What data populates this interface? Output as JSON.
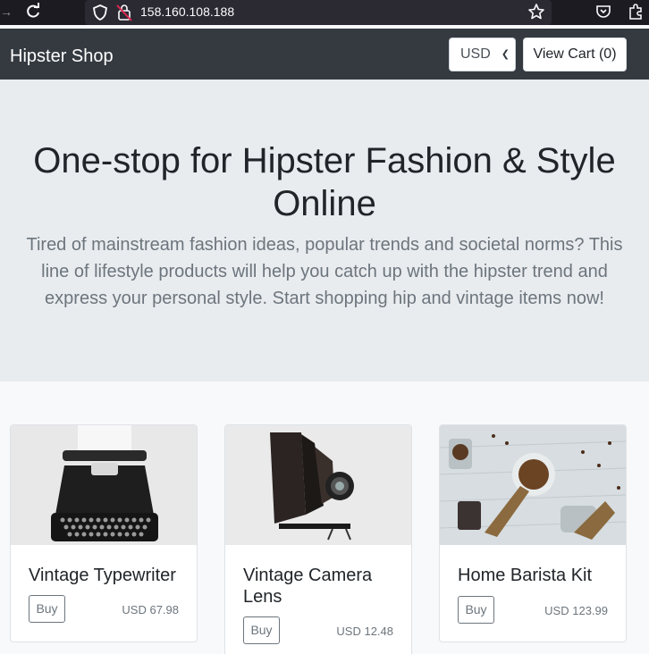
{
  "browser": {
    "url": "158.160.108.188"
  },
  "nav": {
    "brand": "Hipster Shop",
    "currency": "USD",
    "cart_label": "View Cart (0)"
  },
  "hero": {
    "headline": "One-stop for Hipster Fashion & Style Online",
    "tagline": "Tired of mainstream fashion ideas, popular trends and societal norms? This line of lifestyle products will help you catch up with the hipster trend and express your personal style. Start shopping hip and vintage items now!"
  },
  "products": [
    {
      "name": "Vintage Typewriter",
      "buy_label": "Buy",
      "price": "USD 67.98"
    },
    {
      "name": "Vintage Camera Lens",
      "buy_label": "Buy",
      "price": "USD 12.48"
    },
    {
      "name": "Home Barista Kit",
      "buy_label": "Buy",
      "price": "USD 123.99"
    }
  ],
  "colors": {
    "navbar": "#343a40",
    "hero_bg": "#e9ecef",
    "page_bg": "#f8f9fa",
    "muted_text": "#6c757d"
  }
}
